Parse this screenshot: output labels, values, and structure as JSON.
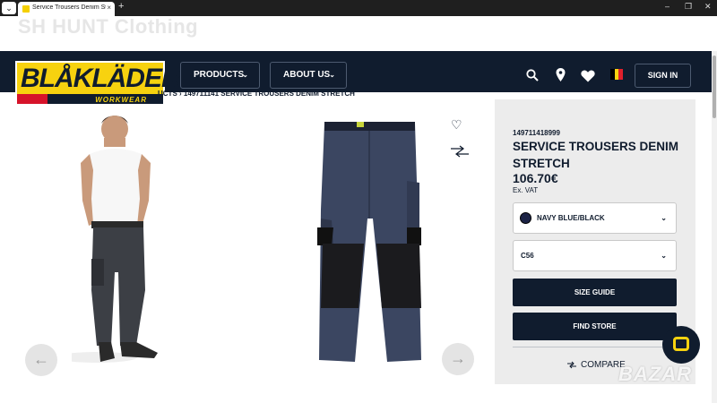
{
  "browser": {
    "tab_title": "Service Trousers Denim Stretch",
    "tab_close": "×",
    "new_tab": "+",
    "menu_icon": "⌄",
    "win_min": "–",
    "win_max": "❐",
    "win_close": "✕"
  },
  "watermarks": {
    "top": "SH HUNT Clothing",
    "bottom": "BAZAR"
  },
  "header": {
    "logo_text": "BLÅKLÄDER",
    "logo_sub": "WORKWEAR",
    "nav": [
      {
        "label": "PRODUCTS",
        "chevron": "⌄"
      },
      {
        "label": "ABOUT US",
        "chevron": "⌄"
      }
    ],
    "sign_in": "SIGN IN",
    "flag_colors": [
      "#000000",
      "#f7d20f",
      "#e0202c"
    ]
  },
  "breadcrumb": "UCTS  ›  149711141 SERVICE TROUSERS DENIM STRETCH",
  "gallery": {
    "prev_icon": "←",
    "next_icon": "→",
    "wishlist_icon": "♡"
  },
  "product": {
    "sku": "149711418999",
    "name": "SERVICE TROUSERS DENIM STRETCH",
    "price": "106.70€",
    "vat_note": "Ex. VAT",
    "color_select": {
      "value": "NAVY BLUE/BLACK",
      "chevron": "⌄"
    },
    "size_select": {
      "value": "C56",
      "chevron": "⌄"
    },
    "size_guide": "SIZE GUIDE",
    "find_store": "FIND STORE",
    "compare": "COMPARE"
  },
  "colors": {
    "navy": "#101c2e",
    "brand_yellow": "#f7d20f",
    "panel_bg": "#ececec"
  }
}
